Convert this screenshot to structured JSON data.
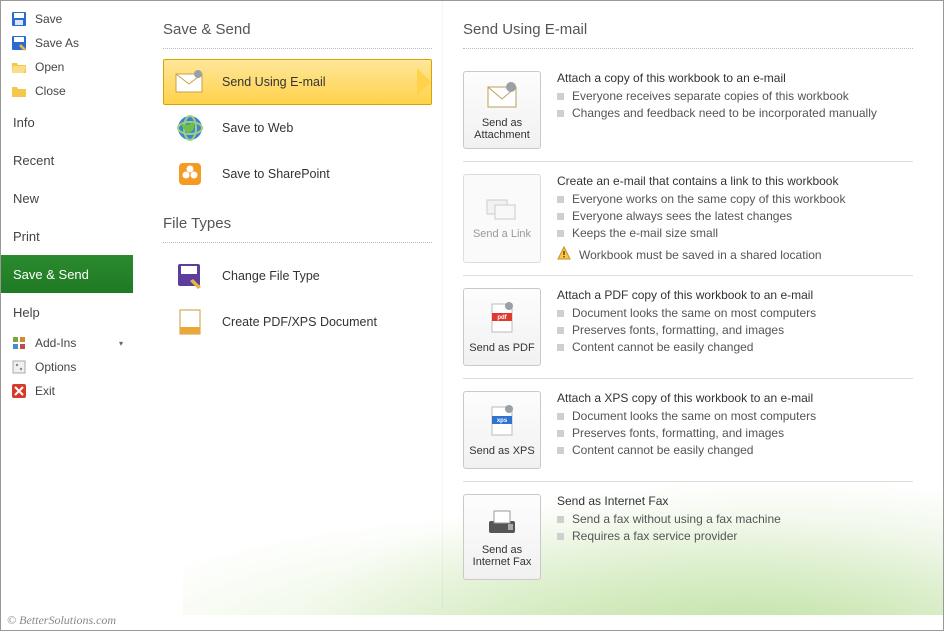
{
  "sidebar": {
    "save": "Save",
    "saveAs": "Save As",
    "open": "Open",
    "close": "Close",
    "info": "Info",
    "recent": "Recent",
    "new": "New",
    "print": "Print",
    "saveSend": "Save & Send",
    "help": "Help",
    "addins": "Add-Ins",
    "options": "Options",
    "exit": "Exit"
  },
  "middle": {
    "groupSaveSend": "Save & Send",
    "sendEmail": "Send Using E-mail",
    "saveWeb": "Save to Web",
    "saveSP": "Save to SharePoint",
    "groupFileTypes": "File Types",
    "changeType": "Change File Type",
    "createPdf": "Create PDF/XPS Document"
  },
  "right": {
    "title": "Send Using E-mail",
    "attach": {
      "btn": "Send as Attachment",
      "heading": "Attach a copy of this workbook to an e-mail",
      "b1": "Everyone receives separate copies of this workbook",
      "b2": "Changes and feedback need to be incorporated manually"
    },
    "link": {
      "btn": "Send a Link",
      "heading": "Create an e-mail that contains a link to this workbook",
      "b1": "Everyone works on the same copy of this workbook",
      "b2": "Everyone always sees the latest changes",
      "b3": "Keeps the e-mail size small",
      "warn": "Workbook must be saved in a shared location"
    },
    "pdf": {
      "btn": "Send as PDF",
      "heading": "Attach a PDF copy of this workbook to an e-mail",
      "b1": "Document looks the same on most computers",
      "b2": "Preserves fonts, formatting, and images",
      "b3": "Content cannot be easily changed"
    },
    "xps": {
      "btn": "Send as XPS",
      "heading": "Attach a XPS copy of this workbook to an e-mail",
      "b1": "Document looks the same on most computers",
      "b2": "Preserves fonts, formatting, and images",
      "b3": "Content cannot be easily changed"
    },
    "fax": {
      "btn": "Send as Internet Fax",
      "heading": "Send as Internet Fax",
      "b1": "Send a fax without using a fax machine",
      "b2": "Requires a fax service provider"
    }
  },
  "footer": "© BetterSolutions.com"
}
